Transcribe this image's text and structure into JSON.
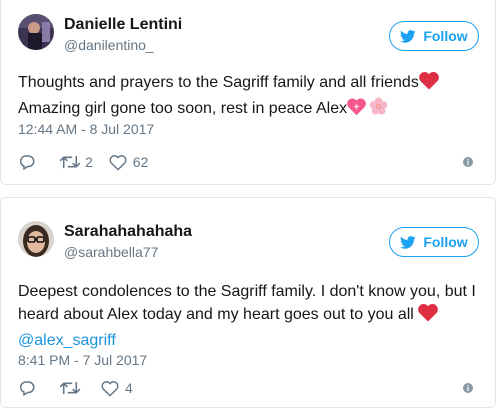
{
  "tweets": [
    {
      "name": "Danielle Lentini",
      "handle": "@danilentino_",
      "follow_label": "Follow",
      "text_line1": "Thoughts and prayers to the Sagriff family and all friends",
      "text_line2": "Amazing girl gone too soon, rest in peace Alex",
      "timestamp": "12:44 AM - 8 Jul 2017",
      "retweets": "2",
      "likes": "62",
      "icons": [
        "reply-icon",
        "retweet-icon",
        "like-icon",
        "info-icon",
        "red-heart-emoji",
        "sparkling-heart-emoji",
        "cherry-blossom-emoji"
      ]
    },
    {
      "name": "Sarahahahahaha",
      "handle": "@sarahbella77",
      "follow_label": "Follow",
      "text_line1": "Deepest condolences to the Sagriff family. I don't know you, but I",
      "text_line2": "heard about Alex today and my heart goes out to you all",
      "mention": "@alex_sagriff",
      "timestamp": "8:41 PM - 7 Jul 2017",
      "retweets": "",
      "likes": "4",
      "icons": [
        "reply-icon",
        "retweet-icon",
        "like-icon",
        "info-icon",
        "red-heart-emoji"
      ]
    }
  ],
  "colors": {
    "accent": "#1da1f2",
    "text": "#14171a",
    "muted": "#657786",
    "border": "#e1e8ed",
    "heart": "#dd2e44"
  }
}
